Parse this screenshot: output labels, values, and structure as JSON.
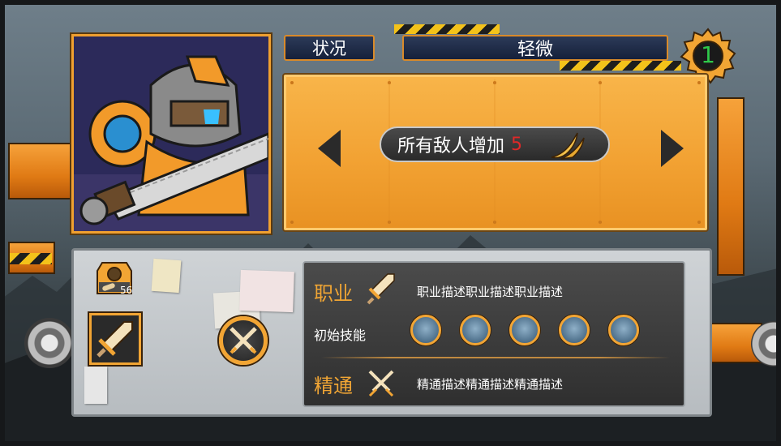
{
  "status": {
    "label": "状况",
    "value": "轻微",
    "level": "1"
  },
  "effect": {
    "text": "所有敌人增加",
    "number": "5",
    "icon": "claw-slash-icon"
  },
  "inventory": {
    "count": "56",
    "icon": "bandage-icon"
  },
  "career": {
    "label": "职业",
    "description": "职业描述职业描述职业描述",
    "icon": "sword-icon"
  },
  "starting_skills": {
    "label": "初始技能",
    "skills": [
      {
        "icon": "skill-scythe-icon"
      },
      {
        "icon": "skill-spear-icon"
      },
      {
        "icon": "skill-blade-icon"
      },
      {
        "icon": "skill-jump-icon"
      },
      {
        "icon": "skill-guard-icon"
      }
    ]
  },
  "mastery": {
    "label": "精通",
    "description": "精通描述精通描述精通描述",
    "icon": "crossed-swords-icon"
  },
  "colors": {
    "accent_orange": "#f2a534",
    "level_green": "#2fc94a",
    "effect_number_red": "#e02828"
  }
}
